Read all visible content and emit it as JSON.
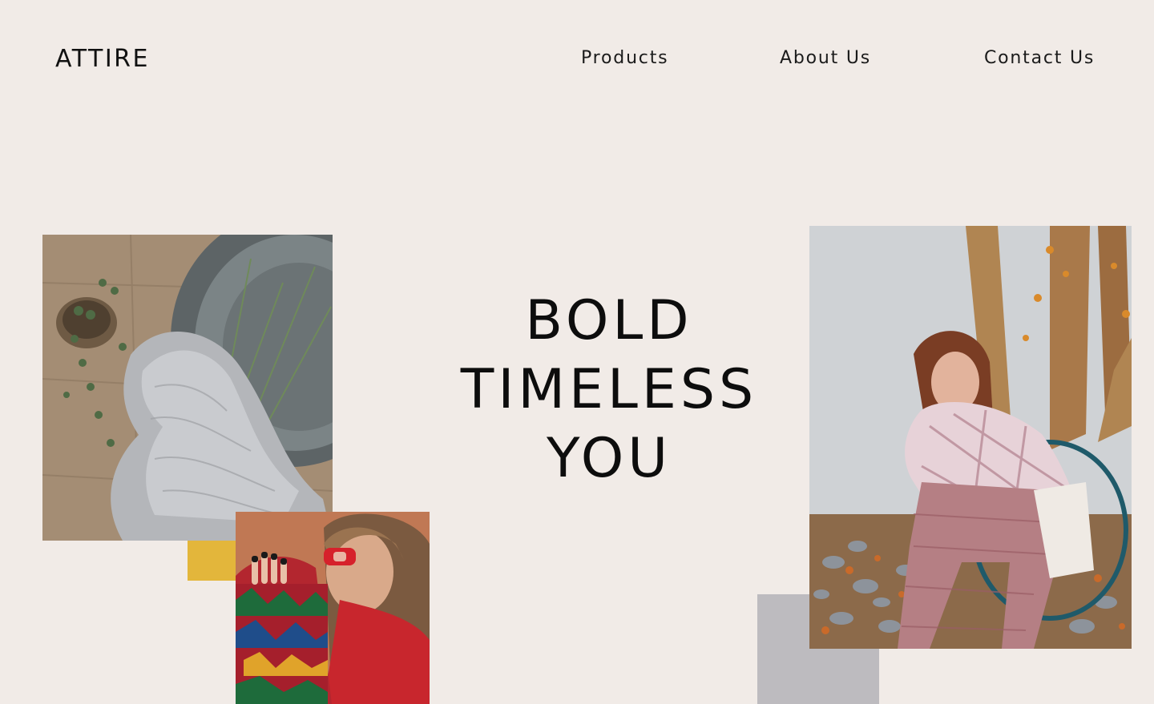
{
  "brand": {
    "logo_text": "ATTIRE"
  },
  "nav": {
    "items": [
      {
        "label": "Products"
      },
      {
        "label": "About Us"
      },
      {
        "label": "Contact Us"
      }
    ]
  },
  "hero": {
    "lines": [
      "BOLD",
      "TIMELESS",
      "YOU"
    ]
  },
  "colors": {
    "background": "#f1ebe7",
    "accent_yellow": "#e3b63b",
    "accent_gray": "#bdbbbf",
    "text": "#111111"
  }
}
